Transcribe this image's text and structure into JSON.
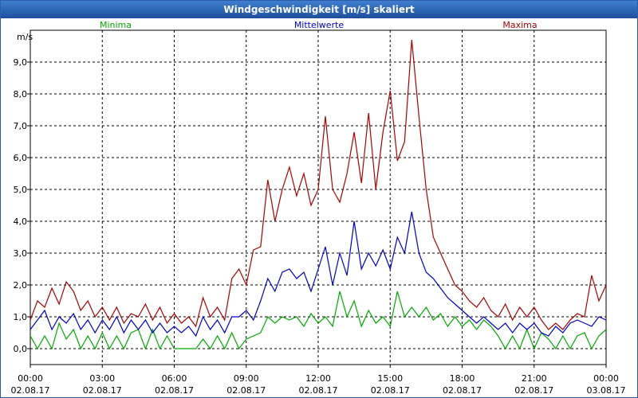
{
  "chart_data": {
    "type": "line",
    "title": "Windgeschwindigkeit [m/s] skaliert",
    "ylabel": "m/s",
    "ylim": [
      -0.5,
      10
    ],
    "y_ticks": [
      "0,0",
      "1,0",
      "2,0",
      "3,0",
      "4,0",
      "5,0",
      "6,0",
      "7,0",
      "8,0",
      "9,0"
    ],
    "x_ticks": [
      {
        "time": "00:00",
        "date": "02.08.17"
      },
      {
        "time": "03:00",
        "date": "02.08.17"
      },
      {
        "time": "06:00",
        "date": "02.08.17"
      },
      {
        "time": "09:00",
        "date": "02.08.17"
      },
      {
        "time": "12:00",
        "date": "02.08.17"
      },
      {
        "time": "15:00",
        "date": "02.08.17"
      },
      {
        "time": "18:00",
        "date": "02.08.17"
      },
      {
        "time": "21:00",
        "date": "02.08.17"
      },
      {
        "time": "00:00",
        "date": "03.08.17"
      }
    ],
    "xlim_hours": [
      0,
      24
    ],
    "grid": true,
    "legend_position": "top",
    "series": [
      {
        "name": "Minima",
        "color": "#00aa00",
        "points": [
          [
            0,
            0.4
          ],
          [
            0.3,
            0
          ],
          [
            0.6,
            0.4
          ],
          [
            0.9,
            0
          ],
          [
            1.2,
            0.8
          ],
          [
            1.5,
            0.3
          ],
          [
            1.8,
            0.6
          ],
          [
            2.1,
            0
          ],
          [
            2.4,
            0.4
          ],
          [
            2.7,
            0
          ],
          [
            3,
            0.5
          ],
          [
            3.3,
            0
          ],
          [
            3.6,
            0.4
          ],
          [
            3.9,
            0
          ],
          [
            4.2,
            0.5
          ],
          [
            4.5,
            0.6
          ],
          [
            4.8,
            0
          ],
          [
            5.1,
            0.6
          ],
          [
            5.4,
            0
          ],
          [
            5.7,
            0.4
          ],
          [
            6,
            0
          ],
          [
            6.3,
            0
          ],
          [
            6.6,
            0
          ],
          [
            6.9,
            0
          ],
          [
            7.2,
            0.3
          ],
          [
            7.5,
            0
          ],
          [
            7.8,
            0.4
          ],
          [
            8.1,
            0
          ],
          [
            8.4,
            0.5
          ],
          [
            8.7,
            0
          ],
          [
            9,
            0.3
          ],
          [
            9.3,
            0.4
          ],
          [
            9.6,
            0.5
          ],
          [
            9.9,
            1.0
          ],
          [
            10.2,
            0.8
          ],
          [
            10.5,
            1.0
          ],
          [
            10.8,
            0.9
          ],
          [
            11.1,
            1.0
          ],
          [
            11.4,
            0.7
          ],
          [
            11.7,
            1.1
          ],
          [
            12,
            0.8
          ],
          [
            12.3,
            1.0
          ],
          [
            12.6,
            0.7
          ],
          [
            12.9,
            1.8
          ],
          [
            13.2,
            1.0
          ],
          [
            13.5,
            1.5
          ],
          [
            13.8,
            0.7
          ],
          [
            14.1,
            1.2
          ],
          [
            14.4,
            0.8
          ],
          [
            14.7,
            1.0
          ],
          [
            15,
            0.7
          ],
          [
            15.3,
            1.8
          ],
          [
            15.6,
            1.0
          ],
          [
            15.9,
            1.3
          ],
          [
            16.2,
            1.0
          ],
          [
            16.5,
            1.3
          ],
          [
            16.8,
            0.9
          ],
          [
            17.1,
            1.1
          ],
          [
            17.4,
            0.7
          ],
          [
            17.7,
            1.0
          ],
          [
            18,
            0.7
          ],
          [
            18.3,
            0.9
          ],
          [
            18.6,
            0.6
          ],
          [
            18.9,
            0.9
          ],
          [
            19.2,
            0.7
          ],
          [
            19.5,
            0.4
          ],
          [
            19.8,
            0
          ],
          [
            20.1,
            0.4
          ],
          [
            20.4,
            0
          ],
          [
            20.7,
            0.6
          ],
          [
            21,
            0
          ],
          [
            21.3,
            0.5
          ],
          [
            21.6,
            0.3
          ],
          [
            21.9,
            0
          ],
          [
            22.2,
            0.4
          ],
          [
            22.5,
            0
          ],
          [
            22.8,
            0.4
          ],
          [
            23.1,
            0.5
          ],
          [
            23.4,
            0
          ],
          [
            23.7,
            0.4
          ],
          [
            24,
            0.6
          ]
        ]
      },
      {
        "name": "Mittelwerte",
        "color": "#0000cc",
        "points": [
          [
            0,
            0.6
          ],
          [
            0.3,
            0.9
          ],
          [
            0.6,
            1.2
          ],
          [
            0.9,
            0.6
          ],
          [
            1.2,
            1.0
          ],
          [
            1.5,
            0.8
          ],
          [
            1.8,
            1.1
          ],
          [
            2.1,
            0.6
          ],
          [
            2.4,
            0.9
          ],
          [
            2.7,
            0.5
          ],
          [
            3,
            0.9
          ],
          [
            3.3,
            0.6
          ],
          [
            3.6,
            1.0
          ],
          [
            3.9,
            0.5
          ],
          [
            4.2,
            0.9
          ],
          [
            4.5,
            0.6
          ],
          [
            4.8,
            0.9
          ],
          [
            5.1,
            0.5
          ],
          [
            5.4,
            0.8
          ],
          [
            5.7,
            0.5
          ],
          [
            6,
            0.7
          ],
          [
            6.3,
            0.5
          ],
          [
            6.6,
            0.7
          ],
          [
            6.9,
            0.4
          ],
          [
            7.2,
            1.0
          ],
          [
            7.5,
            0.6
          ],
          [
            7.8,
            0.9
          ],
          [
            8.1,
            0.5
          ],
          [
            8.4,
            1.0
          ],
          [
            8.7,
            1.0
          ],
          [
            9,
            1.2
          ],
          [
            9.3,
            0.9
          ],
          [
            9.6,
            1.5
          ],
          [
            9.9,
            2.2
          ],
          [
            10.2,
            1.8
          ],
          [
            10.5,
            2.4
          ],
          [
            10.8,
            2.5
          ],
          [
            11.1,
            2.2
          ],
          [
            11.4,
            2.4
          ],
          [
            11.7,
            1.8
          ],
          [
            12,
            2.5
          ],
          [
            12.3,
            3.2
          ],
          [
            12.6,
            2.0
          ],
          [
            12.9,
            3.0
          ],
          [
            13.2,
            2.3
          ],
          [
            13.5,
            4.0
          ],
          [
            13.8,
            2.5
          ],
          [
            14.1,
            3.0
          ],
          [
            14.4,
            2.6
          ],
          [
            14.7,
            3.1
          ],
          [
            15,
            2.5
          ],
          [
            15.3,
            3.5
          ],
          [
            15.6,
            3.0
          ],
          [
            15.9,
            4.3
          ],
          [
            16.2,
            3.0
          ],
          [
            16.5,
            2.4
          ],
          [
            16.8,
            2.2
          ],
          [
            17.1,
            1.9
          ],
          [
            17.4,
            1.6
          ],
          [
            17.7,
            1.4
          ],
          [
            18,
            1.2
          ],
          [
            18.3,
            1.0
          ],
          [
            18.6,
            0.8
          ],
          [
            18.9,
            1.0
          ],
          [
            19.2,
            0.8
          ],
          [
            19.5,
            0.6
          ],
          [
            19.8,
            0.8
          ],
          [
            20.1,
            0.5
          ],
          [
            20.4,
            0.8
          ],
          [
            20.7,
            0.6
          ],
          [
            21,
            0.8
          ],
          [
            21.3,
            0.5
          ],
          [
            21.6,
            0.4
          ],
          [
            21.9,
            0.7
          ],
          [
            22.2,
            0.5
          ],
          [
            22.5,
            0.8
          ],
          [
            22.8,
            0.9
          ],
          [
            23.1,
            0.8
          ],
          [
            23.4,
            0.7
          ],
          [
            23.7,
            1.0
          ],
          [
            24,
            0.9
          ]
        ]
      },
      {
        "name": "Maxima",
        "color": "#aa0000",
        "points": [
          [
            0,
            0.9
          ],
          [
            0.3,
            1.5
          ],
          [
            0.6,
            1.3
          ],
          [
            0.9,
            1.9
          ],
          [
            1.2,
            1.4
          ],
          [
            1.5,
            2.1
          ],
          [
            1.8,
            1.8
          ],
          [
            2.1,
            1.2
          ],
          [
            2.4,
            1.5
          ],
          [
            2.7,
            1.0
          ],
          [
            3,
            1.3
          ],
          [
            3.3,
            0.9
          ],
          [
            3.6,
            1.3
          ],
          [
            3.9,
            0.8
          ],
          [
            4.2,
            1.1
          ],
          [
            4.5,
            1.0
          ],
          [
            4.8,
            1.4
          ],
          [
            5.1,
            0.9
          ],
          [
            5.4,
            1.3
          ],
          [
            5.7,
            0.8
          ],
          [
            6,
            1.1
          ],
          [
            6.3,
            0.8
          ],
          [
            6.6,
            1.0
          ],
          [
            6.9,
            0.7
          ],
          [
            7.2,
            1.6
          ],
          [
            7.5,
            1.0
          ],
          [
            7.8,
            1.3
          ],
          [
            8.1,
            0.9
          ],
          [
            8.4,
            2.2
          ],
          [
            8.7,
            2.5
          ],
          [
            9,
            2.0
          ],
          [
            9.3,
            3.1
          ],
          [
            9.6,
            3.2
          ],
          [
            9.9,
            5.3
          ],
          [
            10.2,
            4.0
          ],
          [
            10.5,
            5.0
          ],
          [
            10.8,
            5.7
          ],
          [
            11.1,
            4.8
          ],
          [
            11.4,
            5.5
          ],
          [
            11.7,
            4.5
          ],
          [
            12,
            5.0
          ],
          [
            12.3,
            7.3
          ],
          [
            12.6,
            5.0
          ],
          [
            12.9,
            4.6
          ],
          [
            13.2,
            5.5
          ],
          [
            13.5,
            6.8
          ],
          [
            13.8,
            5.2
          ],
          [
            14.1,
            7.4
          ],
          [
            14.4,
            5.0
          ],
          [
            14.7,
            6.8
          ],
          [
            15,
            8.1
          ],
          [
            15.3,
            5.9
          ],
          [
            15.6,
            6.5
          ],
          [
            15.9,
            9.7
          ],
          [
            16.2,
            7.3
          ],
          [
            16.5,
            5.0
          ],
          [
            16.8,
            3.5
          ],
          [
            17.1,
            3.0
          ],
          [
            17.4,
            2.5
          ],
          [
            17.7,
            2.0
          ],
          [
            18,
            1.8
          ],
          [
            18.3,
            1.5
          ],
          [
            18.6,
            1.3
          ],
          [
            18.9,
            1.6
          ],
          [
            19.2,
            1.2
          ],
          [
            19.5,
            1.0
          ],
          [
            19.8,
            1.4
          ],
          [
            20.1,
            0.9
          ],
          [
            20.4,
            1.3
          ],
          [
            20.7,
            1.0
          ],
          [
            21,
            1.3
          ],
          [
            21.3,
            0.9
          ],
          [
            21.6,
            0.6
          ],
          [
            21.9,
            0.8
          ],
          [
            22.2,
            0.6
          ],
          [
            22.5,
            0.9
          ],
          [
            22.8,
            1.1
          ],
          [
            23.1,
            1.0
          ],
          [
            23.4,
            2.3
          ],
          [
            23.7,
            1.5
          ],
          [
            24,
            2.0
          ]
        ]
      }
    ]
  }
}
